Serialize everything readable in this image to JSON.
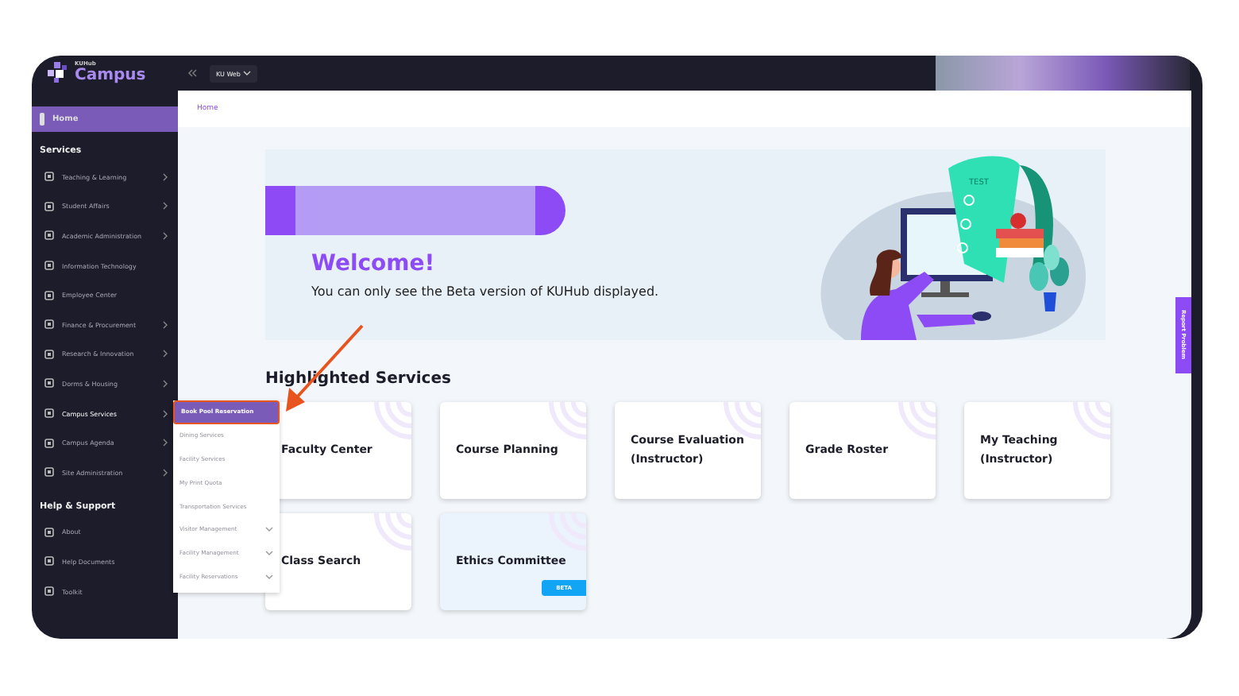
{
  "topbar": {
    "logo_small": "KUHub",
    "logo": "Campus",
    "site_button": "KU Web"
  },
  "sidebar": {
    "home": {
      "label": "Home",
      "selected": true
    },
    "sections": [
      {
        "title": "Services",
        "items": [
          {
            "label": "Teaching & Learning",
            "submenu": true,
            "expanded": false
          },
          {
            "label": "Student Affairs",
            "submenu": true,
            "expanded": false
          },
          {
            "label": "Academic Administration",
            "submenu": true,
            "expanded": false
          },
          {
            "label": "Information Technology",
            "submenu": false,
            "expanded": false
          },
          {
            "label": "Employee Center",
            "submenu": false,
            "expanded": false
          },
          {
            "label": "Finance & Procurement",
            "submenu": true,
            "expanded": false
          },
          {
            "label": "Research & Innovation",
            "submenu": true,
            "expanded": false
          },
          {
            "label": "Dorms & Housing",
            "submenu": true,
            "expanded": false
          },
          {
            "label": "Campus Services",
            "submenu": true,
            "expanded": true
          },
          {
            "label": "Campus Agenda",
            "submenu": true,
            "expanded": false
          },
          {
            "label": "Site Administration",
            "submenu": true,
            "expanded": false
          }
        ]
      },
      {
        "title": "Help & Support",
        "items": [
          {
            "label": "About",
            "submenu": false,
            "expanded": false
          },
          {
            "label": "Help Documents",
            "submenu": false,
            "expanded": false
          },
          {
            "label": "Toolkit",
            "submenu": false,
            "expanded": false
          }
        ]
      }
    ]
  },
  "submenu": {
    "items": [
      {
        "label": "Book Pool Reservation",
        "selected": true,
        "expandable": false
      },
      {
        "label": "Dining Services",
        "selected": false,
        "expandable": false
      },
      {
        "label": "Facility Services",
        "selected": false,
        "expandable": false
      },
      {
        "label": "My Print Quota",
        "selected": false,
        "expandable": false
      },
      {
        "label": "Transportation Services",
        "selected": false,
        "expandable": false
      },
      {
        "label": "Visitor Management",
        "selected": false,
        "expandable": true
      },
      {
        "label": "Facility Management",
        "selected": false,
        "expandable": true
      },
      {
        "label": "Facility Reservations",
        "selected": false,
        "expandable": true
      }
    ]
  },
  "breadcrumb": "Home",
  "banner": {
    "title": "Welcome!",
    "text": "You can only see the Beta version of KUHub displayed.",
    "illustration_text": "TEST"
  },
  "highlighted": {
    "title": "Highlighted Services",
    "cards": [
      {
        "title": "Faculty Center"
      },
      {
        "title": "Course Planning"
      },
      {
        "title": "Course Evaluation (Instructor)"
      },
      {
        "title": "Grade Roster"
      },
      {
        "title": "My Teaching (Instructor)"
      },
      {
        "title": "Class Search"
      },
      {
        "title": "Ethics Committee",
        "badge": "BETA"
      }
    ]
  },
  "report_button": "Report Problem"
}
